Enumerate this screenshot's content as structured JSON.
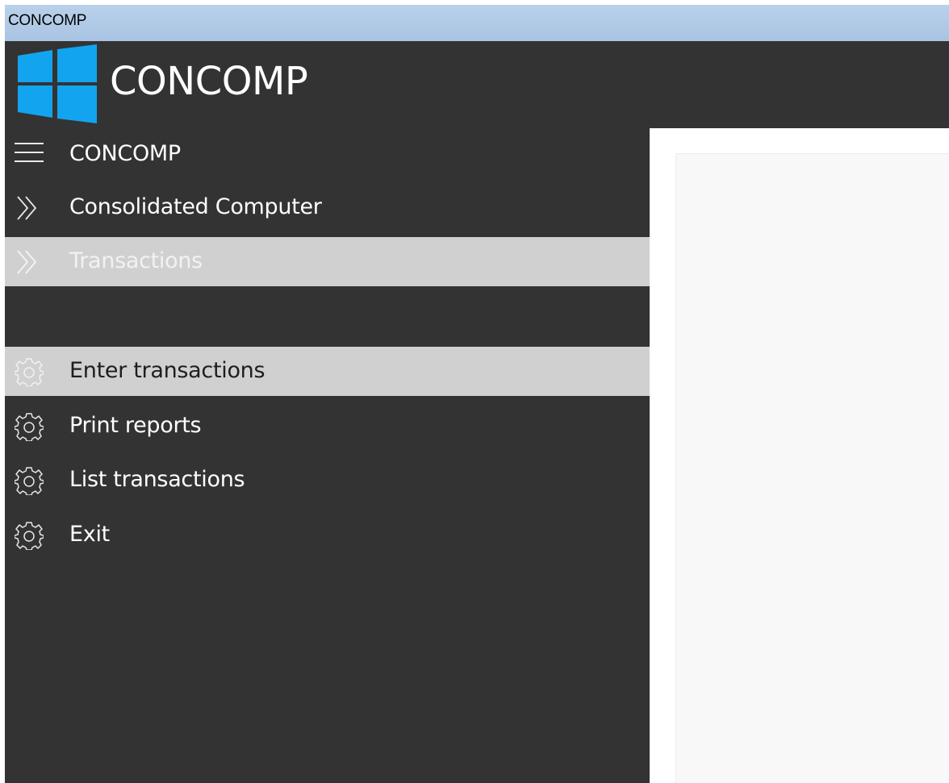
{
  "window": {
    "title": "CONCOMP"
  },
  "header": {
    "logo_icon": "windows-logo",
    "logo_color": "#12a4ef",
    "title": "CONCOMP",
    "background": "#333333"
  },
  "sidebar": {
    "menu_item": {
      "label": "CONCOMP",
      "icon": "hamburger-icon"
    },
    "breadcrumbs": [
      {
        "label": "Consolidated Computer",
        "icon": "double-chevron-icon",
        "selected": false
      },
      {
        "label": "Transactions",
        "icon": "double-chevron-icon",
        "selected": true
      }
    ],
    "actions": [
      {
        "label": "Enter transactions",
        "icon": "gear-icon",
        "selected": true
      },
      {
        "label": "Print reports",
        "icon": "gear-icon",
        "selected": false
      },
      {
        "label": "List transactions",
        "icon": "gear-icon",
        "selected": false
      },
      {
        "label": "Exit",
        "icon": "gear-icon",
        "selected": false
      }
    ],
    "selected_background": "#d0d0d0"
  }
}
